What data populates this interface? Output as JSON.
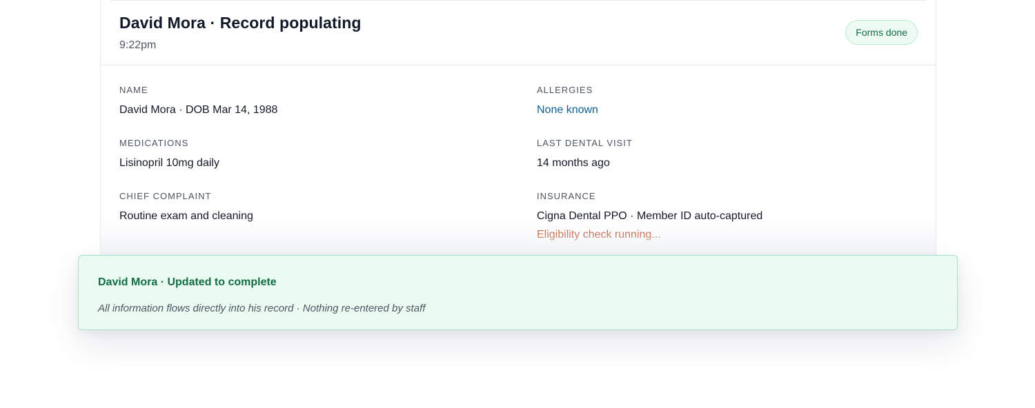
{
  "record": {
    "title": "David Mora · Record populating",
    "time": "9:22pm",
    "badge": "Forms done",
    "fields": {
      "name": {
        "label": "NAME",
        "value": "David Mora · DOB Mar 14, 1988"
      },
      "allergies": {
        "label": "ALLERGIES",
        "value": "None known"
      },
      "medications": {
        "label": "MEDICATIONS",
        "value": "Lisinopril 10mg daily"
      },
      "last_visit": {
        "label": "LAST DENTAL VISIT",
        "value": "14 months ago"
      },
      "complaint": {
        "label": "CHIEF COMPLAINT",
        "value": "Routine exam and cleaning"
      },
      "insurance": {
        "label": "INSURANCE",
        "value": "Cigna Dental PPO · Member ID auto-captured",
        "note": "Eligibility check running..."
      }
    }
  },
  "toast": {
    "title": "David Mora · Updated to complete",
    "body": "All information flows directly into his record · Nothing re-entered by staff"
  },
  "colors": {
    "success": "#146c43",
    "link": "#0d5f93",
    "warning": "#b83a12"
  }
}
